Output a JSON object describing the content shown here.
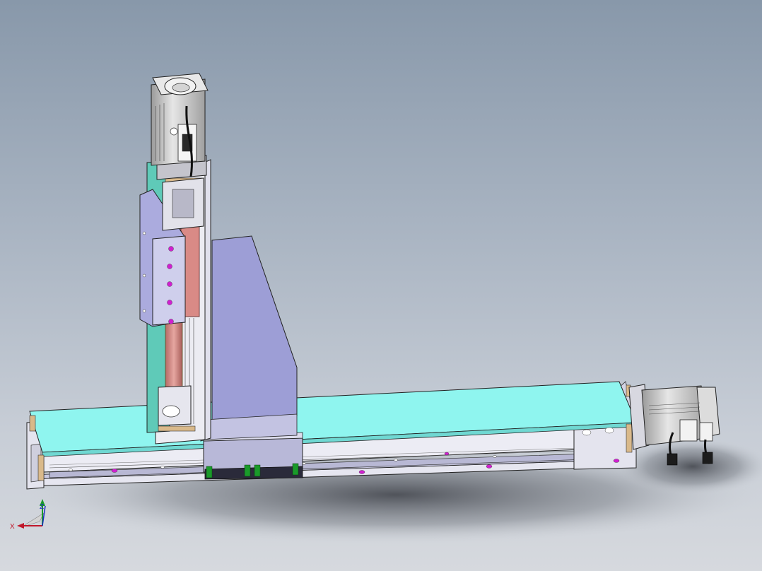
{
  "triad": {
    "x_label": "X",
    "z_label": "Z"
  },
  "colors": {
    "background_top": "#8898aa",
    "background_bottom": "#d6d9de",
    "cover_cyan": "#8ff5ef",
    "teal_plate": "#5fcab8",
    "lavender_body": "#9d9ed6",
    "rail_gray": "#d8d8e6",
    "screw_pink": "#d98a86",
    "motor_gray": "#d2d2d2",
    "bolt_magenta": "#d020d0",
    "spacer_brass": "#d9b98a",
    "bearing_green": "#1a9a2a"
  },
  "icons": [
    "axis-triad-icon"
  ]
}
